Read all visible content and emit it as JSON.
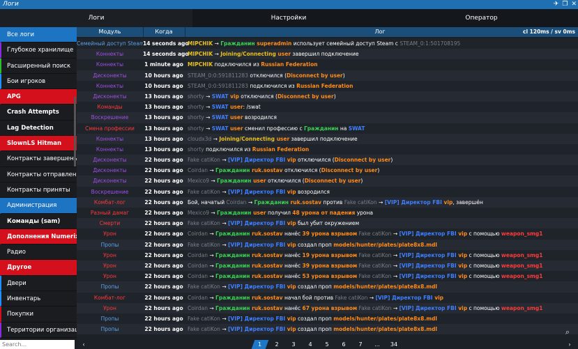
{
  "window": {
    "title": "Логи",
    "controls": [
      "✈",
      "❐",
      "✕"
    ]
  },
  "tabs": [
    "Логи",
    "Настройки",
    "Оператор"
  ],
  "sidebar": {
    "items": [
      {
        "label": "Все логи",
        "style": "blue",
        "accent": ""
      },
      {
        "label": "Глубокое хранилище",
        "style": "",
        "accent": "#8a2be2"
      },
      {
        "label": "Расширенный поиск",
        "style": "",
        "accent": "#2dbd2d"
      },
      {
        "label": "Бои игроков",
        "style": "",
        "accent": "#1e90ff"
      },
      {
        "label": "APG",
        "style": "red",
        "accent": ""
      },
      {
        "label": "Crash Attempts",
        "style": "bold",
        "accent": ""
      },
      {
        "label": "Lag Detection",
        "style": "bold",
        "accent": ""
      },
      {
        "label": "SlownLS Hitman",
        "style": "red",
        "accent": ""
      },
      {
        "label": "Контракты завершены",
        "style": "",
        "accent": ""
      },
      {
        "label": "Контракты отправлены",
        "style": "",
        "accent": ""
      },
      {
        "label": "Контракты приняты",
        "style": "",
        "accent": ""
      },
      {
        "label": "Администрация",
        "style": "blue",
        "accent": ""
      },
      {
        "label": "Команды (sam)",
        "style": "bold",
        "accent": ""
      },
      {
        "label": "Дополнения Numerix",
        "style": "red",
        "accent": ""
      },
      {
        "label": "Радио",
        "style": "",
        "accent": ""
      },
      {
        "label": "Другое",
        "style": "red",
        "accent": ""
      },
      {
        "label": "Двери",
        "style": "",
        "accent": "#1e90ff"
      },
      {
        "label": "Инвентарь",
        "style": "",
        "accent": "#1e90ff"
      },
      {
        "label": "Покупки",
        "style": "",
        "accent": "#d4101c"
      },
      {
        "label": "Территории организац...",
        "style": "",
        "accent": "#8a2be2"
      }
    ],
    "search_placeholder": "Search..."
  },
  "table": {
    "headers": [
      "Модуль",
      "Когда",
      "Лог"
    ],
    "perf": "cl 120ms / sv 0ms"
  },
  "colors": {
    "white": "#ffffff",
    "gray": "#7a7f87",
    "green": "#39d353",
    "yellow": "#e8c020",
    "orange": "#ff8c1a",
    "blue": "#3f7fff",
    "red": "#ff3b3b"
  },
  "rows": [
    {
      "mod": "Семейный доступ Steam",
      "mc": "#5aa0e6",
      "when": "14 seconds ago",
      "log": [
        [
          "MIPCHIK",
          "yellow"
        ],
        [
          " → ",
          "white"
        ],
        [
          "Гражданин",
          "green"
        ],
        [
          " superadmin",
          "orange"
        ],
        [
          " использует семейный доступ Steam c ",
          "white"
        ],
        [
          "STEAM_0:1:501708195",
          "gray"
        ]
      ]
    },
    {
      "mod": "Коннекты",
      "mc": "#a050e6",
      "when": "14 seconds ago",
      "log": [
        [
          "MIPCHIK",
          "yellow"
        ],
        [
          " → ",
          "white"
        ],
        [
          "Joining/Connecting",
          "yellow"
        ],
        [
          " user",
          "orange"
        ],
        [
          " завершил подключение",
          "white"
        ]
      ]
    },
    {
      "mod": "Коннекты",
      "mc": "#a050e6",
      "when": "1 minute ago",
      "log": [
        [
          "MIPCHIK",
          "yellow"
        ],
        [
          " подключился из ",
          "white"
        ],
        [
          "Russian Federation",
          "orange"
        ]
      ]
    },
    {
      "mod": "Дисконекты",
      "mc": "#a050e6",
      "when": "10 hours ago",
      "log": [
        [
          "STEAM_0:0:591811283",
          "gray"
        ],
        [
          " отключился (",
          "white"
        ],
        [
          "Disconnect by user",
          "orange"
        ],
        [
          ")",
          "white"
        ]
      ]
    },
    {
      "mod": "Коннекты",
      "mc": "#a050e6",
      "when": "10 hours ago",
      "log": [
        [
          "STEAM_0:0:591811283",
          "gray"
        ],
        [
          " подключился из ",
          "white"
        ],
        [
          "Russian Federation",
          "orange"
        ]
      ]
    },
    {
      "mod": "Дисконекты",
      "mc": "#a050e6",
      "when": "13 hours ago",
      "log": [
        [
          "shorty",
          "gray"
        ],
        [
          " → ",
          "white"
        ],
        [
          "SWAT",
          "blue"
        ],
        [
          " vip",
          "orange"
        ],
        [
          " отключился (",
          "white"
        ],
        [
          "Disconnect by user",
          "orange"
        ],
        [
          ")",
          "white"
        ]
      ]
    },
    {
      "mod": "Команды",
      "mc": "#ff3b3b",
      "when": "13 hours ago",
      "log": [
        [
          "shorty",
          "gray"
        ],
        [
          " → ",
          "white"
        ],
        [
          "SWAT",
          "blue"
        ],
        [
          " user",
          "orange"
        ],
        [
          ": /swat",
          "white"
        ]
      ]
    },
    {
      "mod": "Воскрешение",
      "mc": "#a050e6",
      "when": "13 hours ago",
      "log": [
        [
          "shorty",
          "gray"
        ],
        [
          " → ",
          "white"
        ],
        [
          "SWAT",
          "blue"
        ],
        [
          " user",
          "orange"
        ],
        [
          " возродился",
          "white"
        ]
      ]
    },
    {
      "mod": "Смена профессии",
      "mc": "#ff3b3b",
      "when": "13 hours ago",
      "log": [
        [
          "shorty",
          "gray"
        ],
        [
          " → ",
          "white"
        ],
        [
          "SWAT",
          "blue"
        ],
        [
          " user",
          "orange"
        ],
        [
          " сменил профессию с ",
          "white"
        ],
        [
          "Гражданин",
          "green"
        ],
        [
          " на ",
          "white"
        ],
        [
          "SWAT",
          "blue"
        ]
      ]
    },
    {
      "mod": "Коннекты",
      "mc": "#a050e6",
      "when": "13 hours ago",
      "log": [
        [
          "cloudx3d",
          "gray"
        ],
        [
          " → ",
          "white"
        ],
        [
          "Joining/Connecting",
          "yellow"
        ],
        [
          " user",
          "orange"
        ],
        [
          " завершил подключение",
          "white"
        ]
      ]
    },
    {
      "mod": "Коннекты",
      "mc": "#a050e6",
      "when": "13 hours ago",
      "log": [
        [
          "shorty",
          "gray"
        ],
        [
          " подключился из ",
          "white"
        ],
        [
          "Russian Federation",
          "orange"
        ]
      ]
    },
    {
      "mod": "Дисконекты",
      "mc": "#a050e6",
      "when": "22 hours ago",
      "log": [
        [
          "Fake catiKon",
          "gray"
        ],
        [
          " → ",
          "white"
        ],
        [
          "[VIP] Директор FBI",
          "blue"
        ],
        [
          " vip",
          "orange"
        ],
        [
          " отключился (",
          "white"
        ],
        [
          "Disconnect by user",
          "orange"
        ],
        [
          ")",
          "white"
        ]
      ]
    },
    {
      "mod": "Дисконекты",
      "mc": "#a050e6",
      "when": "22 hours ago",
      "log": [
        [
          "Coirdan",
          "gray"
        ],
        [
          " → ",
          "white"
        ],
        [
          "Гражданин",
          "green"
        ],
        [
          " ruk.sostav",
          "orange"
        ],
        [
          " отключился (",
          "white"
        ],
        [
          "Disconnect by user",
          "orange"
        ],
        [
          ")",
          "white"
        ]
      ]
    },
    {
      "mod": "Дисконекты",
      "mc": "#a050e6",
      "when": "22 hours ago",
      "log": [
        [
          "Mexico9",
          "gray"
        ],
        [
          " → ",
          "white"
        ],
        [
          "Гражданин",
          "green"
        ],
        [
          " user",
          "orange"
        ],
        [
          " отключился (",
          "white"
        ],
        [
          "Disconnect by user",
          "orange"
        ],
        [
          ")",
          "white"
        ]
      ]
    },
    {
      "mod": "Воскрешение",
      "mc": "#a050e6",
      "when": "22 hours ago",
      "log": [
        [
          "Fake catiKon",
          "gray"
        ],
        [
          " → ",
          "white"
        ],
        [
          "[VIP] Директор FBI",
          "blue"
        ],
        [
          " vip",
          "orange"
        ],
        [
          " возродился",
          "white"
        ]
      ]
    },
    {
      "mod": "Комбат-лог",
      "mc": "#ff3b3b",
      "when": "22 hours ago",
      "log": [
        [
          "Бой, начатый ",
          "white"
        ],
        [
          "Coirdan",
          "gray"
        ],
        [
          " → ",
          "white"
        ],
        [
          "Гражданин",
          "green"
        ],
        [
          " ruk.sostav",
          "orange"
        ],
        [
          " против ",
          "white"
        ],
        [
          "Fake catiKon",
          "gray"
        ],
        [
          " → ",
          "white"
        ],
        [
          "[VIP] Директор FBI",
          "blue"
        ],
        [
          " vip",
          "orange"
        ],
        [
          ", завершён",
          "white"
        ]
      ]
    },
    {
      "mod": "Разный дамаг",
      "mc": "#ff3b3b",
      "when": "22 hours ago",
      "log": [
        [
          "Mexico9",
          "gray"
        ],
        [
          " → ",
          "white"
        ],
        [
          "Гражданин",
          "green"
        ],
        [
          " user",
          "orange"
        ],
        [
          " получил ",
          "white"
        ],
        [
          "48 урона от падения",
          "orange"
        ],
        [
          " урона",
          "white"
        ]
      ]
    },
    {
      "mod": "Смерти",
      "mc": "#ff3b3b",
      "when": "22 hours ago",
      "log": [
        [
          "Fake catiKon",
          "gray"
        ],
        [
          " → ",
          "white"
        ],
        [
          "[VIP] Директор FBI",
          "blue"
        ],
        [
          " vip",
          "orange"
        ],
        [
          " был убит окружением",
          "white"
        ]
      ]
    },
    {
      "mod": "Урон",
      "mc": "#ff3b3b",
      "when": "22 hours ago",
      "log": [
        [
          "Coirdan",
          "gray"
        ],
        [
          " → ",
          "white"
        ],
        [
          "Гражданин",
          "green"
        ],
        [
          " ruk.sostav",
          "orange"
        ],
        [
          " нанёс ",
          "white"
        ],
        [
          "39 урона взрывом",
          "orange"
        ],
        [
          " ",
          "white"
        ],
        [
          "Fake catiKon",
          "gray"
        ],
        [
          " → ",
          "white"
        ],
        [
          "[VIP] Директор FBI",
          "blue"
        ],
        [
          " vip",
          "orange"
        ],
        [
          " с помощью ",
          "white"
        ],
        [
          "weapon_smg1",
          "red"
        ]
      ]
    },
    {
      "mod": "Пропы",
      "mc": "#5aa0e6",
      "when": "22 hours ago",
      "log": [
        [
          "Fake catiKon",
          "gray"
        ],
        [
          " → ",
          "white"
        ],
        [
          "[VIP] Директор FBI",
          "blue"
        ],
        [
          " vip",
          "orange"
        ],
        [
          " создал проп ",
          "white"
        ],
        [
          "models/hunter/plates/plate8x8.mdl",
          "orange"
        ]
      ]
    },
    {
      "mod": "Урон",
      "mc": "#ff3b3b",
      "when": "22 hours ago",
      "log": [
        [
          "Coirdan",
          "gray"
        ],
        [
          " → ",
          "white"
        ],
        [
          "Гражданин",
          "green"
        ],
        [
          " ruk.sostav",
          "orange"
        ],
        [
          " нанёс ",
          "white"
        ],
        [
          "19 урона взрывом",
          "orange"
        ],
        [
          " ",
          "white"
        ],
        [
          "Fake catiKon",
          "gray"
        ],
        [
          " → ",
          "white"
        ],
        [
          "[VIP] Директор FBI",
          "blue"
        ],
        [
          " vip",
          "orange"
        ],
        [
          " с помощью ",
          "white"
        ],
        [
          "weapon_smg1",
          "red"
        ]
      ]
    },
    {
      "mod": "Урон",
      "mc": "#ff3b3b",
      "when": "22 hours ago",
      "log": [
        [
          "Coirdan",
          "gray"
        ],
        [
          " → ",
          "white"
        ],
        [
          "Гражданин",
          "green"
        ],
        [
          " ruk.sostav",
          "orange"
        ],
        [
          " нанёс ",
          "white"
        ],
        [
          "39 урона взрывом",
          "orange"
        ],
        [
          " ",
          "white"
        ],
        [
          "Fake catiKon",
          "gray"
        ],
        [
          " → ",
          "white"
        ],
        [
          "[VIP] Директор FBI",
          "blue"
        ],
        [
          " vip",
          "orange"
        ],
        [
          " с помощью ",
          "white"
        ],
        [
          "weapon_smg1",
          "red"
        ]
      ]
    },
    {
      "mod": "Урон",
      "mc": "#ff3b3b",
      "when": "22 hours ago",
      "log": [
        [
          "Coirdan",
          "gray"
        ],
        [
          " → ",
          "white"
        ],
        [
          "Гражданин",
          "green"
        ],
        [
          " ruk.sostav",
          "orange"
        ],
        [
          " нанёс ",
          "white"
        ],
        [
          "53 урона взрывом",
          "orange"
        ],
        [
          " ",
          "white"
        ],
        [
          "Fake catiKon",
          "gray"
        ],
        [
          " → ",
          "white"
        ],
        [
          "[VIP] Директор FBI",
          "blue"
        ],
        [
          " vip",
          "orange"
        ],
        [
          " с помощью ",
          "white"
        ],
        [
          "weapon_smg1",
          "red"
        ]
      ]
    },
    {
      "mod": "Пропы",
      "mc": "#5aa0e6",
      "when": "22 hours ago",
      "log": [
        [
          "Fake catiKon",
          "gray"
        ],
        [
          " → ",
          "white"
        ],
        [
          "[VIP] Директор FBI",
          "blue"
        ],
        [
          " vip",
          "orange"
        ],
        [
          " создал проп ",
          "white"
        ],
        [
          "models/hunter/plates/plate8x8.mdl",
          "orange"
        ]
      ]
    },
    {
      "mod": "Комбат-лог",
      "mc": "#ff3b3b",
      "when": "22 hours ago",
      "log": [
        [
          "Coirdan",
          "gray"
        ],
        [
          " → ",
          "white"
        ],
        [
          "Гражданин",
          "green"
        ],
        [
          " ruk.sostav",
          "orange"
        ],
        [
          " начал бой против ",
          "white"
        ],
        [
          "Fake catiKon",
          "gray"
        ],
        [
          " → ",
          "white"
        ],
        [
          "[VIP] Директор FBI",
          "blue"
        ],
        [
          " vip",
          "orange"
        ]
      ]
    },
    {
      "mod": "Урон",
      "mc": "#ff3b3b",
      "when": "22 hours ago",
      "log": [
        [
          "Coirdan",
          "gray"
        ],
        [
          " → ",
          "white"
        ],
        [
          "Гражданин",
          "green"
        ],
        [
          " ruk.sostav",
          "orange"
        ],
        [
          " нанёс ",
          "white"
        ],
        [
          "67 урона взрывом",
          "orange"
        ],
        [
          " ",
          "white"
        ],
        [
          "Fake catiKon",
          "gray"
        ],
        [
          " → ",
          "white"
        ],
        [
          "[VIP] Директор FBI",
          "blue"
        ],
        [
          " vip",
          "orange"
        ],
        [
          " с помощью ",
          "white"
        ],
        [
          "weapon_smg1",
          "red"
        ]
      ]
    },
    {
      "mod": "Пропы",
      "mc": "#5aa0e6",
      "when": "22 hours ago",
      "log": [
        [
          "Fake catiKon",
          "gray"
        ],
        [
          " → ",
          "white"
        ],
        [
          "[VIP] Директор FBI",
          "blue"
        ],
        [
          " vip",
          "orange"
        ],
        [
          " создал проп ",
          "white"
        ],
        [
          "models/hunter/plates/plate8x8.mdl",
          "orange"
        ]
      ]
    },
    {
      "mod": "Пропы",
      "mc": "#5aa0e6",
      "when": "22 hours ago",
      "log": [
        [
          "Fake catiKon",
          "gray"
        ],
        [
          " → ",
          "white"
        ],
        [
          "[VIP] Директор FBI",
          "blue"
        ],
        [
          " vip",
          "orange"
        ],
        [
          " создал проп ",
          "white"
        ],
        [
          "models/hunter/plates/plate8x8.mdl",
          "orange"
        ]
      ]
    }
  ],
  "pager": {
    "prev": "‹",
    "next": "›",
    "pages": [
      "1",
      "2",
      "3",
      "4",
      "5",
      "6",
      "7",
      "...",
      "34"
    ],
    "active": "1"
  },
  "search_icon": "⌕"
}
